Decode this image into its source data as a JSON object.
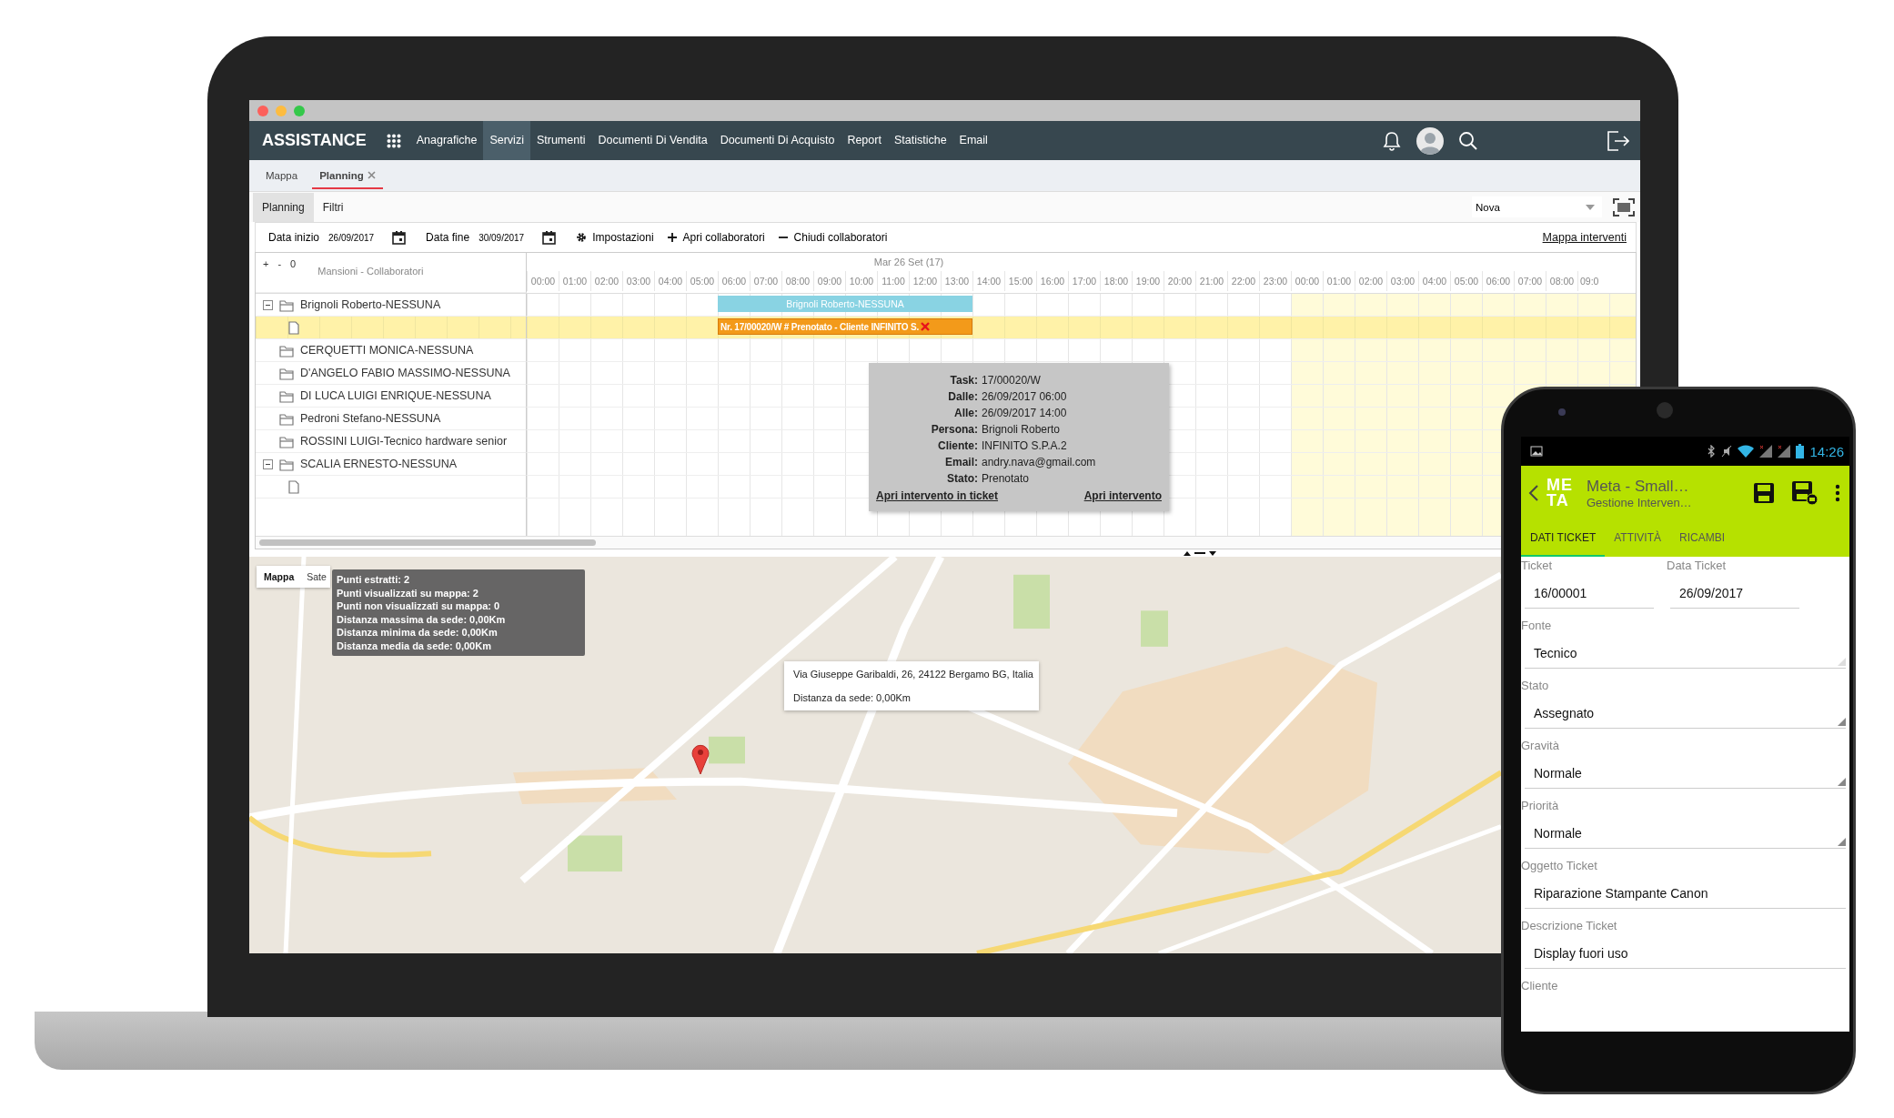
{
  "laptop": {
    "app_title": "ASSISTANCE",
    "nav": [
      {
        "label": "Anagrafiche",
        "selected": false
      },
      {
        "label": "Servizi",
        "selected": true
      },
      {
        "label": "Strumenti",
        "selected": false
      },
      {
        "label": "Documenti Di Vendita",
        "selected": false
      },
      {
        "label": "Documenti Di Acquisto",
        "selected": false
      },
      {
        "label": "Report",
        "selected": false
      },
      {
        "label": "Statistiche",
        "selected": false
      },
      {
        "label": "Email",
        "selected": false
      }
    ],
    "page_tabs": [
      {
        "label": "Mappa",
        "selected": false,
        "closable": false
      },
      {
        "label": "Planning",
        "selected": true,
        "closable": true
      }
    ],
    "sub_tabs": [
      {
        "label": "Planning",
        "selected": true
      },
      {
        "label": "Filtri",
        "selected": false
      }
    ],
    "resource_select": {
      "value": "Nova"
    },
    "toolbar": {
      "start_label": "Data inizio",
      "start_value": "26/09/2017",
      "end_label": "Data fine",
      "end_value": "30/09/2017",
      "actions": [
        {
          "kind": "settings",
          "label": "Impostazioni"
        },
        {
          "kind": "expand",
          "label": "Apri collaboratori"
        },
        {
          "kind": "collapse",
          "label": "Chiudi collaboratori"
        }
      ],
      "link": "Mappa interventi"
    },
    "gantt": {
      "zoom_controls": [
        "+",
        "-",
        "0"
      ],
      "column_title": "Mansioni - Collaboratori",
      "day_label": "Mar 26 Set (17)",
      "hours": [
        "00:00",
        "01:00",
        "02:00",
        "03:00",
        "04:00",
        "05:00",
        "06:00",
        "07:00",
        "08:00",
        "09:00",
        "10:00",
        "11:00",
        "12:00",
        "13:00",
        "14:00",
        "15:00",
        "16:00",
        "17:00",
        "18:00",
        "19:00",
        "20:00",
        "21:00",
        "22:00",
        "23:00",
        "00:00",
        "01:00",
        "02:00",
        "03:00",
        "04:00",
        "05:00",
        "06:00",
        "07:00",
        "08:00",
        "09:0"
      ],
      "rows": [
        {
          "label": "Brignoli Roberto-NESSUNA",
          "expanded": true,
          "bar": {
            "label": "Brignoli Roberto-NESSUNA"
          },
          "children": [
            {
              "kind": "task",
              "selected": true,
              "bar": {
                "label": "Nr. 17/00020/W # Prenotato - Cliente INFINITO S."
              }
            }
          ]
        },
        {
          "label": "CERQUETTI MONICA-NESSUNA"
        },
        {
          "label": "D'ANGELO FABIO MASSIMO-NESSUNA"
        },
        {
          "label": "DI LUCA LUIGI ENRIQUE-NESSUNA"
        },
        {
          "label": "Pedroni Stefano-NESSUNA"
        },
        {
          "label": "ROSSINI LUIGI-Tecnico hardware senior"
        },
        {
          "label": "SCALIA ERNESTO-NESSUNA",
          "expanded": true,
          "children": [
            {
              "kind": "task",
              "selected": false
            }
          ]
        }
      ]
    },
    "tooltip": {
      "fields": [
        {
          "label": "Task:",
          "value": "17/00020/W"
        },
        {
          "label": "Dalle:",
          "value": "26/09/2017 06:00"
        },
        {
          "label": "Alle:",
          "value": "26/09/2017 14:00"
        },
        {
          "label": "Persona:",
          "value": "Brignoli Roberto"
        },
        {
          "label": "Cliente:",
          "value": "INFINITO S.P.A.2"
        },
        {
          "label": "Email:",
          "value": "andry.nava@gmail.com"
        },
        {
          "label": "Stato:",
          "value": "Prenotato"
        }
      ],
      "links": [
        "Apri intervento in ticket",
        "Apri intervento"
      ]
    },
    "map": {
      "type_buttons": [
        {
          "label": "Mappa",
          "selected": true
        },
        {
          "label": "Sate",
          "selected": false
        }
      ],
      "stats": [
        "Punti estratti: 2",
        "Punti visualizzati su mappa: 2",
        "Punti non visualizzati su mappa: 0",
        "Distanza massima da sede: 0,00Km",
        "Distanza minima da sede: 0,00Km",
        "Distanza media da sede: 0,00Km"
      ],
      "popup": {
        "address": "Via Giuseppe Garibaldi, 26, 24122 Bergamo BG, Italia",
        "distance": "Distanza da sede: 0,00Km"
      }
    }
  },
  "phone": {
    "time": "14:26",
    "app_bar": {
      "logo": "ME TA",
      "title": "Meta - Small…",
      "subtitle": "Gestione Interven…"
    },
    "tabs": [
      {
        "label": "DATI TICKET",
        "selected": true
      },
      {
        "label": "ATTIVITÀ",
        "selected": false
      },
      {
        "label": "RICAMBI",
        "selected": false
      }
    ],
    "rows": [
      {
        "fields": [
          {
            "kind": "text",
            "label": "Ticket",
            "value": "16/00001"
          },
          {
            "kind": "text",
            "label": "Data Ticket",
            "value": "26/09/2017"
          }
        ]
      },
      {
        "fields": [
          {
            "kind": "select",
            "label": "Fonte",
            "value": "Tecnico",
            "disabled": true
          }
        ]
      },
      {
        "fields": [
          {
            "kind": "select",
            "label": "Stato",
            "value": "Assegnato",
            "disabled": false
          }
        ]
      },
      {
        "fields": [
          {
            "kind": "select",
            "label": "Gravità",
            "value": "Normale",
            "disabled": false
          }
        ]
      },
      {
        "fields": [
          {
            "kind": "select",
            "label": "Priorità",
            "value": "Normale",
            "disabled": false
          }
        ]
      },
      {
        "fields": [
          {
            "kind": "text",
            "label": "Oggetto Ticket",
            "value": "Riparazione Stampante Canon"
          }
        ]
      },
      {
        "fields": [
          {
            "kind": "text",
            "label": "Descrizione Ticket",
            "value": "Display fuori uso"
          }
        ]
      },
      {
        "fields": [
          {
            "kind": "label",
            "label": "Cliente"
          }
        ]
      }
    ]
  }
}
